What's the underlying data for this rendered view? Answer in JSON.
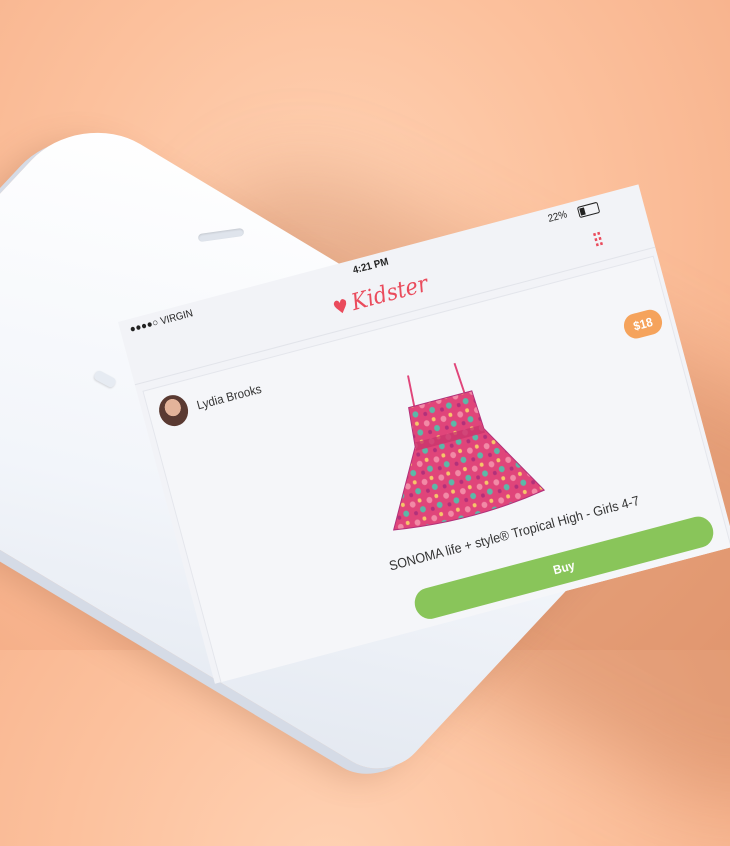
{
  "status": {
    "carrier": "●●●●○ VIRGIN",
    "time": "4:21 PM",
    "battery": "22%"
  },
  "app": {
    "logo_text": "Kidster",
    "accent": "#ea4b5c"
  },
  "post": {
    "user_name": "Lydia Brooks",
    "price": "$18",
    "product_title": "SONOMA life + style® Tropical High - Girls 4-7",
    "buy_label": "Buy"
  },
  "colors": {
    "price_badge": "#f5a35c",
    "buy_button": "#89c55a",
    "background": "#fcc19d"
  }
}
